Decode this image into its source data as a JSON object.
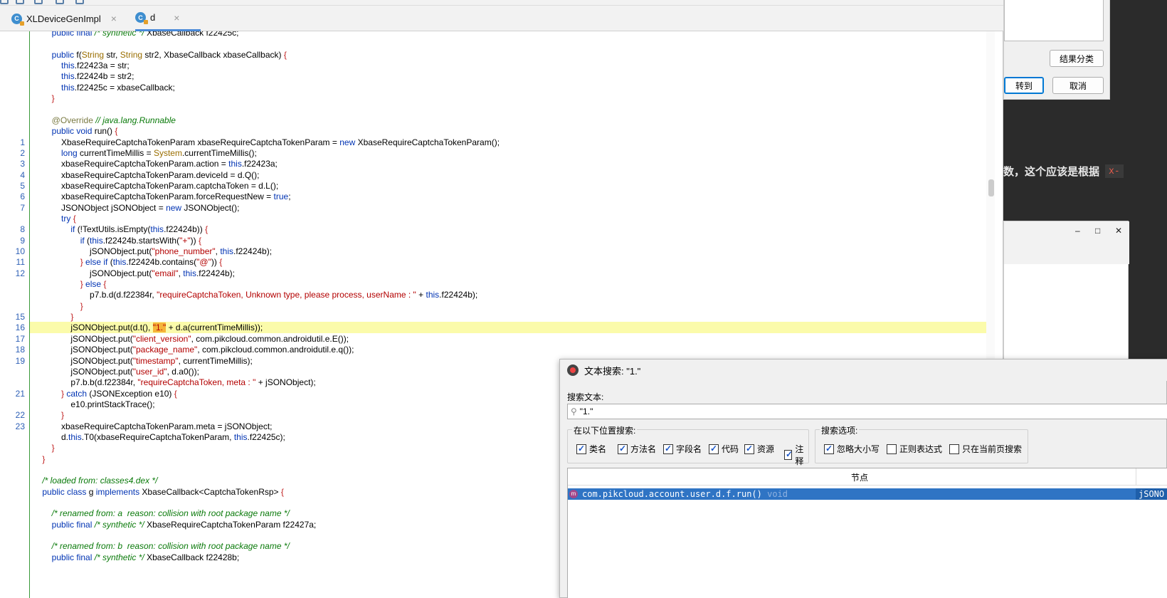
{
  "ide": {
    "tabs": [
      {
        "label": "XLDeviceGenImpl",
        "icon": "class-icon",
        "active": false
      },
      {
        "label": "d",
        "icon": "class-icon",
        "active": true
      }
    ],
    "line_numbers": [
      {
        "row": 10,
        "n": "1"
      },
      {
        "row": 11,
        "n": "2"
      },
      {
        "row": 12,
        "n": "3"
      },
      {
        "row": 13,
        "n": "4"
      },
      {
        "row": 14,
        "n": "5"
      },
      {
        "row": 15,
        "n": "6"
      },
      {
        "row": 16,
        "n": "7"
      },
      {
        "row": 18,
        "n": "8"
      },
      {
        "row": 19,
        "n": "9"
      },
      {
        "row": 20,
        "n": "10"
      },
      {
        "row": 21,
        "n": "11"
      },
      {
        "row": 22,
        "n": "12"
      },
      {
        "row": 26,
        "n": "15"
      },
      {
        "row": 27,
        "n": "16"
      },
      {
        "row": 28,
        "n": "17"
      },
      {
        "row": 29,
        "n": "18"
      },
      {
        "row": 30,
        "n": "19"
      },
      {
        "row": 33,
        "n": "21"
      },
      {
        "row": 35,
        "n": "22"
      },
      {
        "row": 36,
        "n": "23"
      }
    ],
    "code_lines": [
      [
        [
          "        ",
          ""
        ],
        [
          "public final ",
          "kw"
        ],
        [
          "/* synthetic */ ",
          "cm"
        ],
        [
          "XbaseCallback f22425c;",
          ""
        ]
      ],
      [],
      [
        [
          "        ",
          ""
        ],
        [
          "public ",
          "kw"
        ],
        [
          "f(",
          ""
        ],
        [
          "String ",
          "ty"
        ],
        [
          "str, ",
          ""
        ],
        [
          "String ",
          "ty"
        ],
        [
          "str2, XbaseCallback xbaseCallback) ",
          ""
        ],
        [
          "{",
          "br"
        ]
      ],
      [
        [
          "            ",
          ""
        ],
        [
          "this",
          "kw"
        ],
        [
          ".f22423a = str;",
          ""
        ]
      ],
      [
        [
          "            ",
          ""
        ],
        [
          "this",
          "kw"
        ],
        [
          ".f22424b = str2;",
          ""
        ]
      ],
      [
        [
          "            ",
          ""
        ],
        [
          "this",
          "kw"
        ],
        [
          ".f22425c = xbaseCallback;",
          ""
        ]
      ],
      [
        [
          "        ",
          ""
        ],
        [
          "}",
          "br"
        ]
      ],
      [],
      [
        [
          "        ",
          ""
        ],
        [
          "@Override ",
          "an"
        ],
        [
          "// java.lang.Runnable",
          "cm"
        ]
      ],
      [
        [
          "        ",
          ""
        ],
        [
          "public void ",
          "kw"
        ],
        [
          "run() ",
          ""
        ],
        [
          "{",
          "br"
        ]
      ],
      [
        [
          "            XbaseRequireCaptchaTokenParam xbaseRequireCaptchaTokenParam = ",
          ""
        ],
        [
          "new ",
          "kw"
        ],
        [
          "XbaseRequireCaptchaTokenParam();",
          ""
        ]
      ],
      [
        [
          "            ",
          ""
        ],
        [
          "long ",
          "kw"
        ],
        [
          "currentTimeMillis = ",
          ""
        ],
        [
          "System",
          "ty"
        ],
        [
          ".currentTimeMillis();",
          ""
        ]
      ],
      [
        [
          "            xbaseRequireCaptchaTokenParam.action = ",
          ""
        ],
        [
          "this",
          "kw"
        ],
        [
          ".f22423a;",
          ""
        ]
      ],
      [
        [
          "            xbaseRequireCaptchaTokenParam.deviceId = d.Q();",
          ""
        ]
      ],
      [
        [
          "            xbaseRequireCaptchaTokenParam.captchaToken = d.L();",
          ""
        ]
      ],
      [
        [
          "            xbaseRequireCaptchaTokenParam.forceRequestNew = ",
          ""
        ],
        [
          "true",
          "kw"
        ],
        [
          ";",
          ""
        ]
      ],
      [
        [
          "            JSONObject jSONObject = ",
          ""
        ],
        [
          "new ",
          "kw"
        ],
        [
          "JSONObject();",
          ""
        ]
      ],
      [
        [
          "            ",
          ""
        ],
        [
          "try ",
          "kw"
        ],
        [
          "{",
          "br"
        ]
      ],
      [
        [
          "                ",
          ""
        ],
        [
          "if ",
          "kw"
        ],
        [
          "(!TextUtils.isEmpty(",
          ""
        ],
        [
          "this",
          "kw"
        ],
        [
          ".f22424b)) ",
          ""
        ],
        [
          "{",
          "br"
        ]
      ],
      [
        [
          "                    ",
          ""
        ],
        [
          "if ",
          "kw"
        ],
        [
          "(",
          ""
        ],
        [
          "this",
          "kw"
        ],
        [
          ".f22424b.startsWith(",
          ""
        ],
        [
          "\"+\"",
          "st"
        ],
        [
          ")) ",
          ""
        ],
        [
          "{",
          "br"
        ]
      ],
      [
        [
          "                        jSONObject.put(",
          ""
        ],
        [
          "\"phone_number\"",
          "st"
        ],
        [
          ", ",
          ""
        ],
        [
          "this",
          "kw"
        ],
        [
          ".f22424b);",
          ""
        ]
      ],
      [
        [
          "                    ",
          ""
        ],
        [
          "} ",
          "br"
        ],
        [
          "else if ",
          "kw"
        ],
        [
          "(",
          ""
        ],
        [
          "this",
          "kw"
        ],
        [
          ".f22424b.contains(",
          ""
        ],
        [
          "\"@\"",
          "st"
        ],
        [
          ")) ",
          ""
        ],
        [
          "{",
          "br"
        ]
      ],
      [
        [
          "                        jSONObject.put(",
          ""
        ],
        [
          "\"email\"",
          "st"
        ],
        [
          ", ",
          ""
        ],
        [
          "this",
          "kw"
        ],
        [
          ".f22424b);",
          ""
        ]
      ],
      [
        [
          "                    ",
          ""
        ],
        [
          "} ",
          "br"
        ],
        [
          "else ",
          "kw"
        ],
        [
          "{",
          "br"
        ]
      ],
      [
        [
          "                        p7.b.d(d.f22384r, ",
          ""
        ],
        [
          "\"requireCaptchaToken, Unknown type, please process, userName : \" ",
          "st"
        ],
        [
          "+ ",
          ""
        ],
        [
          "this",
          "kw"
        ],
        [
          ".f22424b);",
          ""
        ]
      ],
      [
        [
          "                    ",
          ""
        ],
        [
          "}",
          "br"
        ]
      ],
      [
        [
          "                ",
          ""
        ],
        [
          "}",
          "br"
        ]
      ],
      [
        [
          "                jSONObject.put(d.t(), ",
          ""
        ],
        [
          "\"1.\"",
          "mark"
        ],
        [
          " + d.a(currentTimeMillis));",
          ""
        ]
      ],
      [
        [
          "                jSONObject.put(",
          ""
        ],
        [
          "\"client_version\"",
          "st"
        ],
        [
          ", com.pikcloud.common.androidutil.e.E());",
          ""
        ]
      ],
      [
        [
          "                jSONObject.put(",
          ""
        ],
        [
          "\"package_name\"",
          "st"
        ],
        [
          ", com.pikcloud.common.androidutil.e.q());",
          ""
        ]
      ],
      [
        [
          "                jSONObject.put(",
          ""
        ],
        [
          "\"timestamp\"",
          "st"
        ],
        [
          ", currentTimeMillis);",
          ""
        ]
      ],
      [
        [
          "                jSONObject.put(",
          ""
        ],
        [
          "\"user_id\"",
          "st"
        ],
        [
          ", d.a0());",
          ""
        ]
      ],
      [
        [
          "                p7.b.b(d.f22384r, ",
          ""
        ],
        [
          "\"requireCaptchaToken, meta : \" ",
          "st"
        ],
        [
          "+ jSONObject);",
          ""
        ]
      ],
      [
        [
          "            ",
          ""
        ],
        [
          "} ",
          "br"
        ],
        [
          "catch ",
          "kw"
        ],
        [
          "(JSONException e10) ",
          ""
        ],
        [
          "{",
          "br"
        ]
      ],
      [
        [
          "                e10.printStackTrace();",
          ""
        ]
      ],
      [
        [
          "            ",
          ""
        ],
        [
          "}",
          "br"
        ]
      ],
      [
        [
          "            xbaseRequireCaptchaTokenParam.meta = jSONObject;",
          ""
        ]
      ],
      [
        [
          "            d.",
          ""
        ],
        [
          "this",
          "kw"
        ],
        [
          ".T0(xbaseRequireCaptchaTokenParam, ",
          ""
        ],
        [
          "this",
          "kw"
        ],
        [
          ".f22425c);",
          ""
        ]
      ],
      [
        [
          "        ",
          ""
        ],
        [
          "}",
          "br"
        ]
      ],
      [
        [
          "    ",
          ""
        ],
        [
          "}",
          "br"
        ]
      ],
      [],
      [
        [
          "    ",
          ""
        ],
        [
          "/* loaded from: classes4.dex */",
          "cm"
        ]
      ],
      [
        [
          "    ",
          ""
        ],
        [
          "public class ",
          "kw"
        ],
        [
          "g ",
          ""
        ],
        [
          "implements ",
          "kw"
        ],
        [
          "XbaseCallback<CaptchaTokenRsp> ",
          ""
        ],
        [
          "{",
          "br"
        ]
      ],
      [],
      [
        [
          "        ",
          ""
        ],
        [
          "/* renamed from: a  reason: collision with root package name */",
          "cm"
        ]
      ],
      [
        [
          "        ",
          ""
        ],
        [
          "public final ",
          "kw"
        ],
        [
          "/* synthetic */ ",
          "cm"
        ],
        [
          "XbaseRequireCaptchaTokenParam f22427a;",
          ""
        ]
      ],
      [],
      [
        [
          "        ",
          ""
        ],
        [
          "/* renamed from: b  reason: collision with root package name */",
          "cm"
        ]
      ],
      [
        [
          "        ",
          ""
        ],
        [
          "public final ",
          "kw"
        ],
        [
          "/* synthetic */ ",
          "cm"
        ],
        [
          "XbaseCallback f22428b;",
          ""
        ]
      ]
    ],
    "highlight_row": 27
  },
  "goto_dialog": {
    "classify_button": "结果分类",
    "goto_button": "转到",
    "cancel_button": "取消"
  },
  "background": {
    "text": "数，这个应该是根据",
    "code_fragment": "x-",
    "window_controls": {
      "minimize": "–",
      "maximize": "□",
      "close": "✕"
    }
  },
  "search_dialog": {
    "title": "文本搜索: \"1.\"",
    "search_label": "搜索文本:",
    "search_value": "\"1.\"",
    "scope_title": "在以下位置搜索:",
    "scope_options": [
      {
        "label": "类名",
        "checked": true
      },
      {
        "label": "方法名",
        "checked": true
      },
      {
        "label": "字段名",
        "checked": true
      },
      {
        "label": "代码",
        "checked": true
      },
      {
        "label": "资源",
        "checked": true
      },
      {
        "label": "注释",
        "checked": true
      }
    ],
    "options_title": "搜索选项:",
    "search_options": [
      {
        "label": "忽略大小写",
        "checked": true
      },
      {
        "label": "正则表达式",
        "checked": false
      },
      {
        "label": "只在当前页搜索",
        "checked": false
      }
    ],
    "columns": [
      "节点"
    ],
    "result": {
      "icon_letter": "m",
      "node": "com.pikcloud.account.user.d.f.run()",
      "return_type": "void",
      "code": "jSONO"
    }
  }
}
